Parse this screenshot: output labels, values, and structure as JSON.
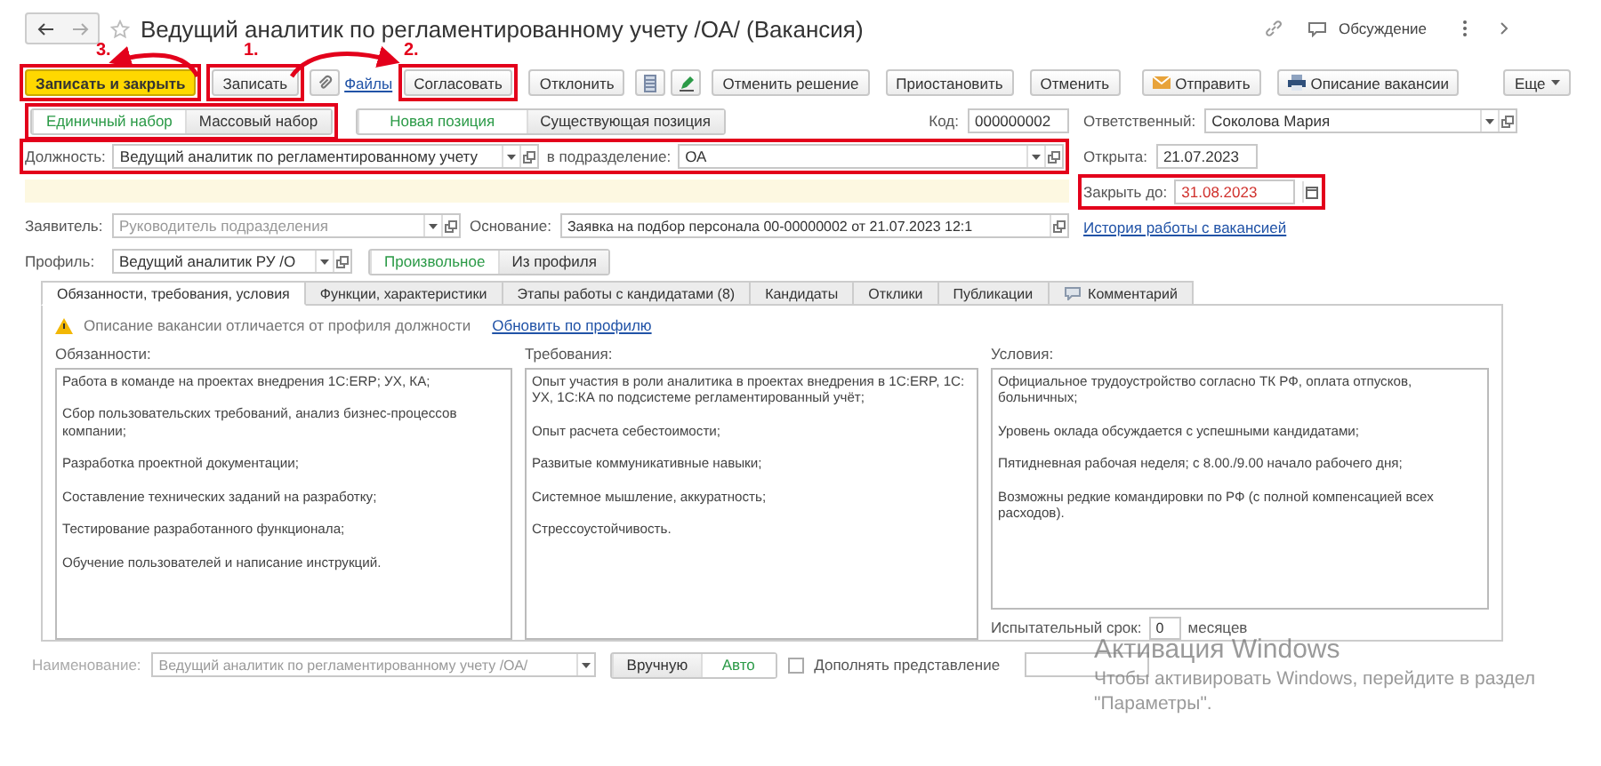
{
  "header": {
    "title": "Ведущий аналитик по регламентированному учету /ОА/ (Вакансия)",
    "discussion": "Обсуждение"
  },
  "annotations": [
    {
      "label": "3."
    },
    {
      "label": "1."
    },
    {
      "label": "2."
    }
  ],
  "toolbar": [
    {
      "kind": "primary",
      "label": "Записать и закрыть",
      "highlighted": true
    },
    {
      "kind": "button",
      "label": "Записать",
      "highlighted": true
    },
    {
      "kind": "attach"
    },
    {
      "kind": "link",
      "label": "Файлы"
    },
    {
      "kind": "button",
      "label": "Согласовать",
      "highlighted": true
    },
    {
      "kind": "button",
      "label": "Отклонить",
      "highlighted": false
    },
    {
      "kind": "table"
    },
    {
      "kind": "edit"
    },
    {
      "kind": "button",
      "label": "Отменить решение",
      "highlighted": false
    },
    {
      "kind": "button",
      "label": "Приостановить",
      "highlighted": false
    },
    {
      "kind": "button",
      "label": "Отменить",
      "highlighted": false
    },
    {
      "kind": "mail",
      "label": "Отправить"
    },
    {
      "kind": "print",
      "label": "Описание вакансии"
    },
    {
      "kind": "menu",
      "label": "Еще"
    }
  ],
  "recruitment": {
    "highlighted": true,
    "options": [
      {
        "label": "Единичный набор",
        "selected": true
      },
      {
        "label": "Массовый набор",
        "selected": false
      }
    ]
  },
  "position_type": {
    "options": [
      {
        "label": "Новая позиция",
        "selected": true
      },
      {
        "label": "Существующая позиция",
        "selected": false
      }
    ]
  },
  "code": {
    "label": "Код:",
    "value": "000000002"
  },
  "responsible": {
    "label": "Ответственный:",
    "value": "Соколова Мария"
  },
  "position": {
    "label": "Должность:",
    "value": "Ведущий аналитик по регламентированному учету",
    "department_label": "в подразделение:",
    "department": "ОА",
    "highlighted": true
  },
  "opened": {
    "label": "Открыта:",
    "value": "21.07.2023"
  },
  "close_by": {
    "label": "Закрыть до:",
    "value": "31.08.2023",
    "highlighted": true
  },
  "history_link": "История работы с вакансией",
  "applicant": {
    "label": "Заявитель:",
    "placeholder": "Руководитель подразделения"
  },
  "basis": {
    "label": "Основание:",
    "value": "Заявка на подбор персонала 00-00000002 от 21.07.2023 12:1"
  },
  "profile": {
    "label": "Профиль:",
    "value": "Ведущий аналитик РУ /О",
    "options": [
      {
        "label": "Произвольное",
        "selected": true
      },
      {
        "label": "Из профиля",
        "selected": false
      }
    ]
  },
  "tabs": [
    {
      "label": "Обязанности, требования, условия",
      "selected": true,
      "kind": "text"
    },
    {
      "label": "Функции, характеристики",
      "selected": false,
      "kind": "text"
    },
    {
      "label": "Этапы работы с кандидатами (8)",
      "selected": false,
      "kind": "text"
    },
    {
      "label": "Кандидаты",
      "selected": false,
      "kind": "text"
    },
    {
      "label": "Отклики",
      "selected": false,
      "kind": "text"
    },
    {
      "label": "Публикации",
      "selected": false,
      "kind": "text"
    },
    {
      "label": "Комментарий",
      "selected": false,
      "kind": "comment"
    }
  ],
  "warning": {
    "text": "Описание вакансии отличается от профиля должности",
    "link": "Обновить по профилю"
  },
  "columns": [
    {
      "label": "Обязанности:",
      "lines": [
        "Работа в команде на проектах внедрения 1С:ERP; УХ, КА;",
        "Сбор пользовательских требований, анализ бизнес-процессов компании;",
        "Разработка проектной документации;",
        "Составление технических заданий на разработку;",
        "Тестирование разработанного функционала;",
        "Обучение пользователей и написание инструкций."
      ]
    },
    {
      "label": "Требования:",
      "lines": [
        "Опыт участия в роли аналитика в проектах внедрения в 1С:ERP, 1С: УХ, 1С:КА по подсистеме регламентированный учёт;",
        "Опыт расчета себестоимости;",
        "Развитые коммуникативные навыки;",
        "Системное мышление, аккуратность;",
        "Стрессоустойчивость."
      ]
    },
    {
      "label": "Условия:",
      "lines": [
        "Официальное трудоустройство согласно ТК РФ, оплата отпусков, больничных;",
        "Уровень оклада обсуждается с успешными кандидатами;",
        "Пятидневная рабочая неделя; с 8.00./9.00 начало рабочего дня;",
        "Возможны редкие командировки по РФ (с полной компенсацией всех расходов)."
      ]
    }
  ],
  "probation": {
    "label": "Испытательный срок:",
    "value": "0",
    "unit": "месяцев"
  },
  "name_row": {
    "label": "Наименование:",
    "value": "Ведущий аналитик по регламентированному учету /ОА/",
    "disabled": true,
    "modes": [
      {
        "label": "Вручную",
        "selected": false
      },
      {
        "label": "Авто",
        "selected": true
      }
    ],
    "append": {
      "label": "Дополнять представление",
      "checked": false
    }
  },
  "os_notice": {
    "title": "Активация Windows",
    "lines": [
      "Чтобы активировать Windows, перейдите в раздел",
      "\"Параметры\"."
    ]
  }
}
